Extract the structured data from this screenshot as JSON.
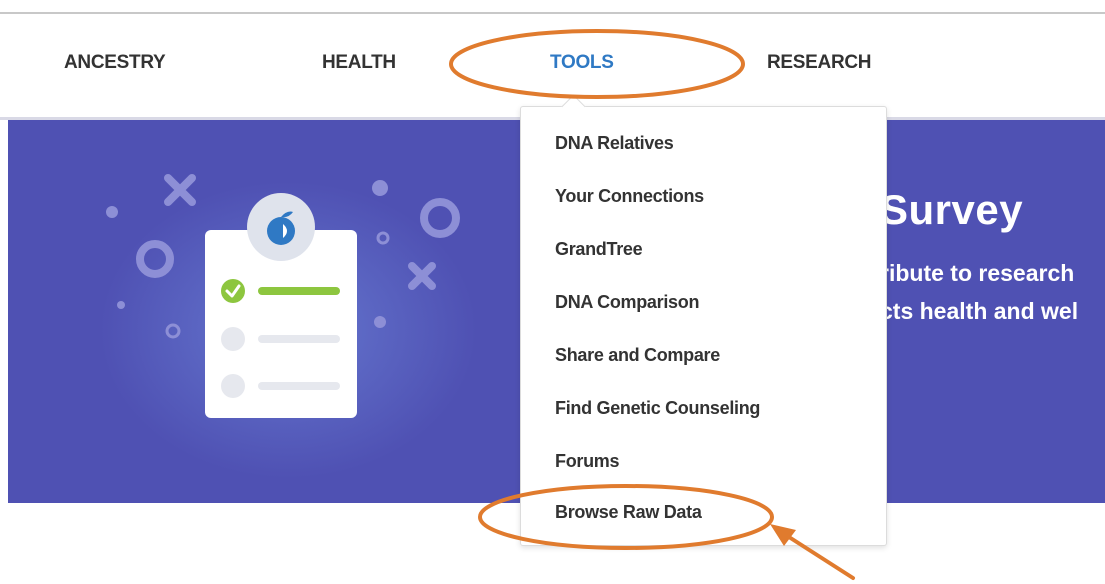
{
  "nav": {
    "items": [
      {
        "label": "ANCESTRY",
        "active": false
      },
      {
        "label": "HEALTH",
        "active": false
      },
      {
        "label": "TOOLS",
        "active": true
      },
      {
        "label": "RESEARCH",
        "active": false
      }
    ]
  },
  "tools_menu": {
    "items": [
      "DNA Relatives",
      "Your Connections",
      "GrandTree",
      "DNA Comparison",
      "Share and Compare",
      "Find Genetic Counseling",
      "Forums",
      "Browse Raw Data"
    ]
  },
  "banner": {
    "title_partial": "Survey",
    "line1_partial": "ribute to research",
    "line2_partial": "cts health and wel"
  },
  "colors": {
    "banner_bg": "#4f51b3",
    "active_nav": "#2f79c4",
    "annotation_orange": "#e07b2e",
    "check_green": "#8dc63f",
    "logo_blue": "#2f79c4"
  },
  "icons": {
    "survey_illustration": "clipboard-checklist-icon",
    "logo": "apple-logo-icon",
    "check": "check-icon",
    "annotation_arrow": "arrow-icon"
  }
}
